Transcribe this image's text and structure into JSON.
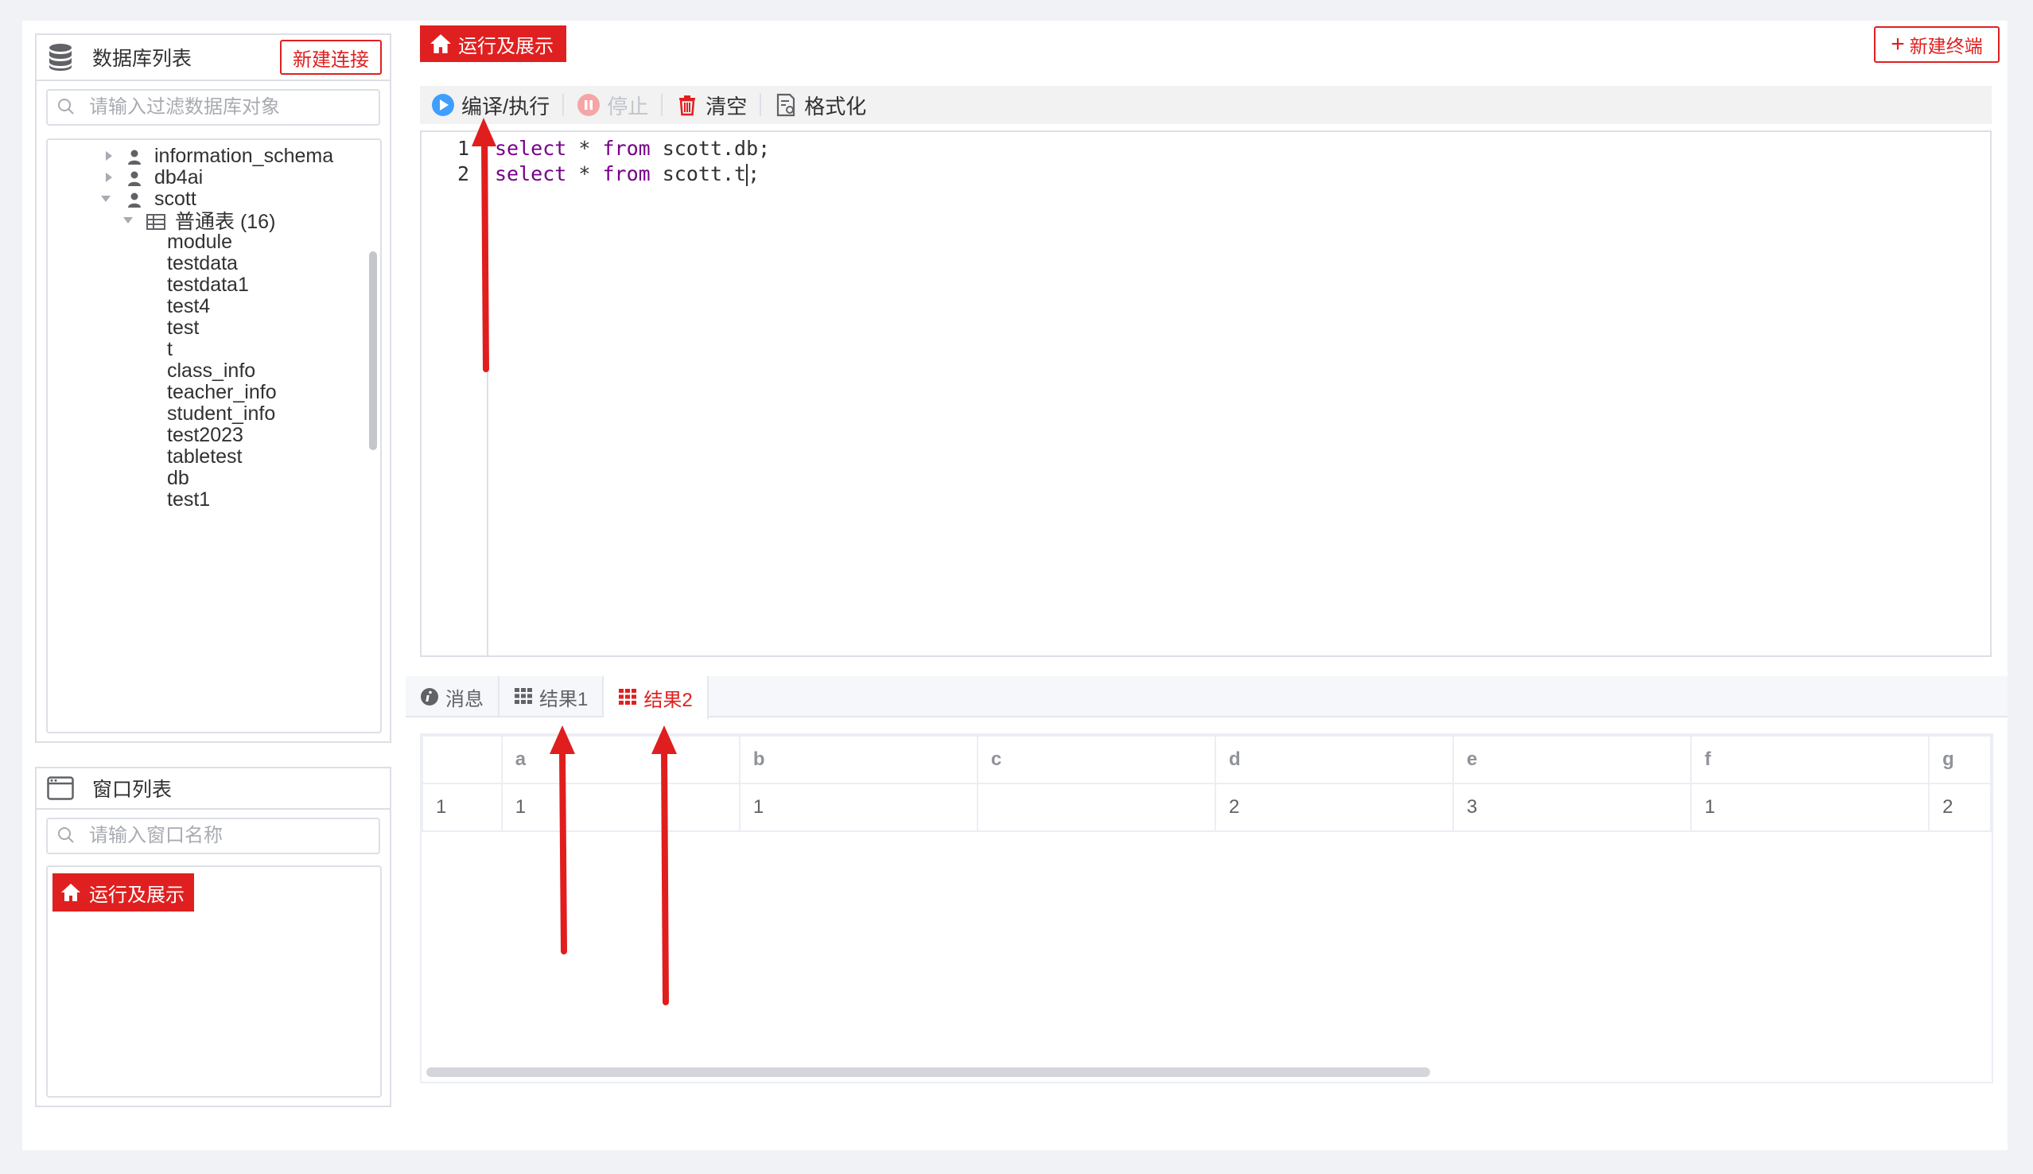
{
  "db_panel": {
    "title": "数据库列表",
    "new_conn_label": "新建连接",
    "filter_placeholder": "请输入过滤数据库对象",
    "tree": {
      "schemas": [
        "information_schema",
        "db4ai",
        "scott"
      ],
      "group_label": "普通表 (16)",
      "tables": [
        "module",
        "testdata",
        "testdata1",
        "test4",
        "test",
        "t",
        "class_info",
        "teacher_info",
        "student_info",
        "test2023",
        "tabletest",
        "db",
        "test1"
      ]
    }
  },
  "window_panel": {
    "title": "窗口列表",
    "filter_placeholder": "请输入窗口名称",
    "items": [
      "运行及展示"
    ]
  },
  "top_tab": {
    "label": "运行及展示"
  },
  "new_terminal_label": "新建终端",
  "toolbar": {
    "run_label": "编译/执行",
    "stop_label": "停止",
    "clear_label": "清空",
    "format_label": "格式化"
  },
  "editor": {
    "lines": [
      {
        "no": "1",
        "kw1": "select",
        "mid": " * ",
        "kw2": "from",
        "rest": " scott.db;"
      },
      {
        "no": "2",
        "kw1": "select",
        "mid": " * ",
        "kw2": "from",
        "rest": " scott.t;"
      }
    ]
  },
  "result_tabs": {
    "messages": "消息",
    "result1": "结果1",
    "result2": "结果2",
    "active": "结果2"
  },
  "result_table": {
    "columns": [
      "",
      "a",
      "b",
      "c",
      "d",
      "e",
      "f",
      "g"
    ],
    "rows": [
      [
        "1",
        "1",
        "1",
        "",
        "2",
        "3",
        "1",
        "2"
      ]
    ]
  },
  "colors": {
    "accent": "#e02020",
    "keyword": "#770088",
    "run_icon": "#409eff",
    "border": "#dcdfe6"
  },
  "icons": [
    "database-icon",
    "search-icon",
    "caret-right-icon",
    "caret-down-icon",
    "user-icon",
    "table-grid-icon",
    "window-icon",
    "home-icon",
    "plus-icon",
    "play-icon",
    "pause-icon",
    "trash-icon",
    "format-icon",
    "info-icon",
    "grid-icon"
  ]
}
